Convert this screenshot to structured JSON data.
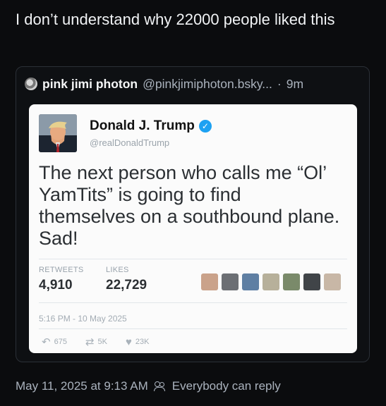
{
  "post": {
    "text": "I don’t understand why 22000 people liked this"
  },
  "quote": {
    "author_name": "pink jimi photon",
    "author_handle": "@pinkjimiphoton.bsky...",
    "separator": "·",
    "time": "9m"
  },
  "tweet": {
    "name": "Donald J. Trump",
    "handle": "@realDonaldTrump",
    "body": "The next person who calls me “Ol’ YamTits” is going to find themselves on a southbound plane. Sad!",
    "retweets_label": "RETWEETS",
    "retweets_value": "4,910",
    "likes_label": "LIKES",
    "likes_value": "22,729",
    "date": "5:16 PM - 10 May 2025",
    "reply_count": "675",
    "retweet_count": "5K",
    "like_count": "23K",
    "liker_colors": [
      "#caa28a",
      "#6c6f74",
      "#5f7fa3",
      "#b7b09a",
      "#7a8a6a",
      "#404448",
      "#c8b7a6"
    ]
  },
  "meta": {
    "timestamp": "May 11, 2025 at 9:13 AM",
    "reply_setting": "Everybody can reply"
  }
}
